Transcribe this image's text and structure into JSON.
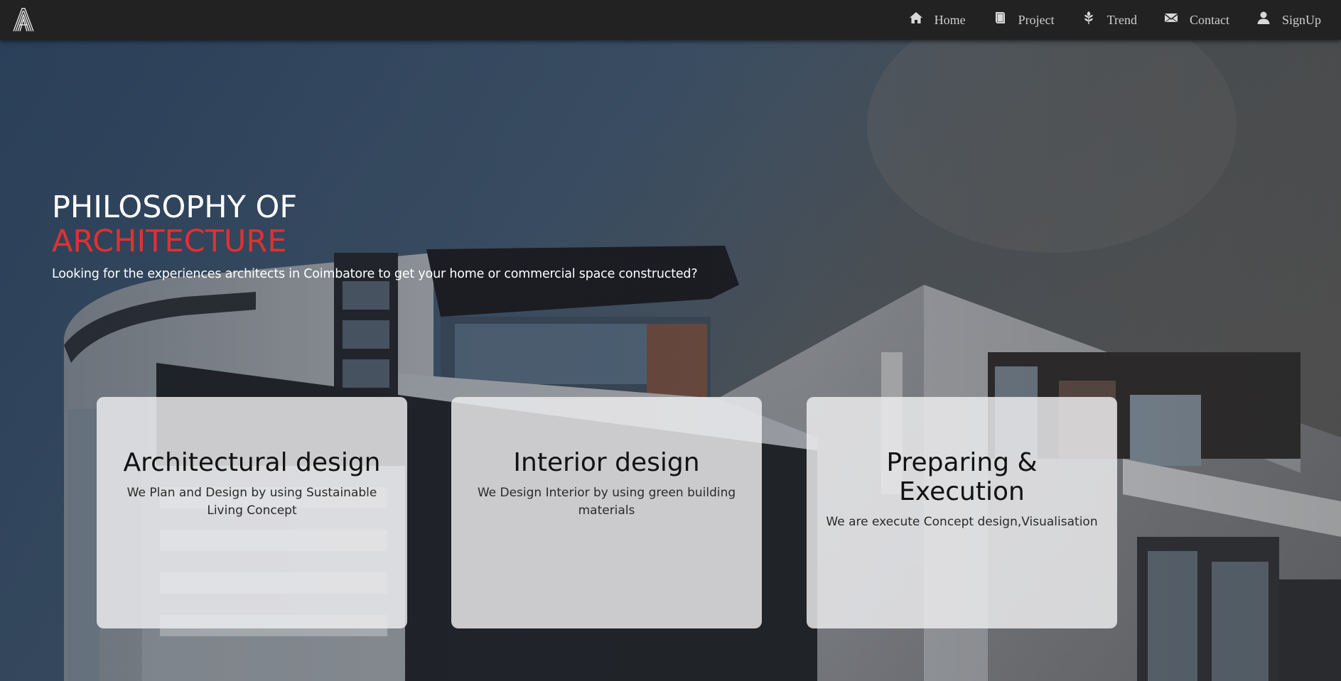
{
  "nav": {
    "logo_icon": "a-lettermark-logo",
    "items": [
      {
        "label": "Home",
        "icon": "home-icon"
      },
      {
        "label": "Project",
        "icon": "book-icon"
      },
      {
        "label": "Trend",
        "icon": "wheat-icon"
      },
      {
        "label": "Contact",
        "icon": "envelope-icon"
      },
      {
        "label": "SignUp",
        "icon": "user-icon"
      }
    ]
  },
  "hero": {
    "title_line1": "PHILOSOPHY OF",
    "title_line2": "ARCHITECTURE",
    "subtitle": "Looking for the experiences architects in Coimbatore to get your home or commercial space constructed?",
    "accent_color": "#e03131"
  },
  "cards": [
    {
      "title": "Architectural design",
      "desc": "We Plan and Design by using Sustainable Living Concept"
    },
    {
      "title": "Interior design",
      "desc": "We Design Interior by using green building materials"
    },
    {
      "title": "Preparing & Execution",
      "desc": "We are execute Concept design,Visualisation"
    }
  ]
}
